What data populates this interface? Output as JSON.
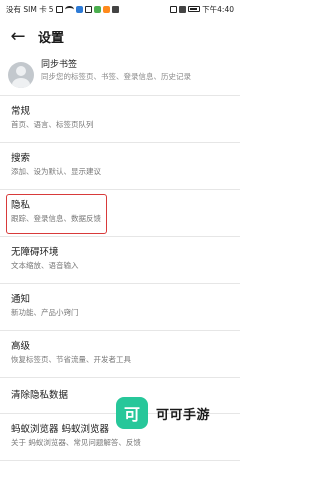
{
  "status_bar": {
    "carrier": "没有 SIM 卡",
    "network": "5",
    "time": "下午4:40",
    "colors": {
      "green_app": "#4caf50",
      "blue_app": "#2e7bd6",
      "orange_app": "#ff8a1c"
    }
  },
  "toolbar": {
    "back_icon": "arrow-left-icon",
    "title": "设置"
  },
  "sync": {
    "title": "同步书签",
    "subtitle": "同步您的标签页、书签、登录信息、历史记录",
    "avatar_icon": "user-avatar-icon"
  },
  "settings": [
    {
      "title": "常规",
      "subtitle": "首页、语言、标签页队列"
    },
    {
      "title": "搜索",
      "subtitle": "添加、设为默认、显示建议"
    },
    {
      "title": "隐私",
      "subtitle": "跟踪、登录信息、数据反馈",
      "highlighted": true,
      "highlight_color": "#d83a3a"
    },
    {
      "title": "无障碍环境",
      "subtitle": "文本缩放、语音输入"
    },
    {
      "title": "通知",
      "subtitle": "新功能、产品小窍门"
    },
    {
      "title": "高级",
      "subtitle": "恢复标签页、节省流量、开发者工具"
    },
    {
      "title": "清除隐私数据"
    },
    {
      "title": "蚂蚁浏览器 蚂蚁浏览器",
      "subtitle": "关于 蚂蚁浏览器、常见问题解答、反馈"
    }
  ],
  "watermark": {
    "logo_char": "可",
    "text": "可可手游",
    "color": "#27c79a"
  }
}
